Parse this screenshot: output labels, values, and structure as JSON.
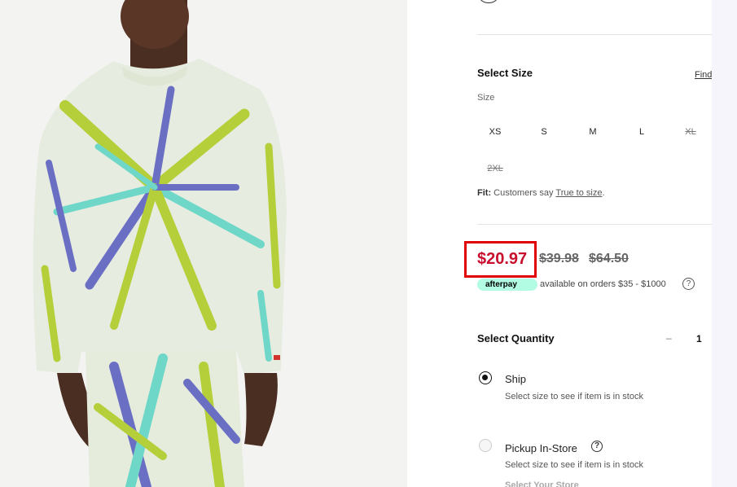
{
  "product_image": {
    "alt": "tie-dye crewneck sweatshirt and matching pants worn by model"
  },
  "size_section": {
    "title": "Select Size",
    "find_link": "Find",
    "size_label": "Size",
    "sizes": [
      {
        "label": "XS",
        "available": true
      },
      {
        "label": "S",
        "available": true
      },
      {
        "label": "M",
        "available": true
      },
      {
        "label": "L",
        "available": true
      },
      {
        "label": "XL",
        "available": false
      },
      {
        "label": "2XL",
        "available": false
      }
    ],
    "fit_prefix": "Fit:",
    "fit_text": "Customers say",
    "fit_link": "True to size",
    "fit_suffix": "."
  },
  "price": {
    "sale": "$20.97",
    "was_1": "$39.98",
    "was_2": "$64.50",
    "highlight_color": "#e00000",
    "sale_color": "#c8102e"
  },
  "afterpay": {
    "badge": "afterpay",
    "text": "available on orders $35 - $1000",
    "help_glyph": "?"
  },
  "quantity": {
    "title": "Select Quantity",
    "minus": "–",
    "value": "1"
  },
  "fulfillment": {
    "ship_label": "Ship",
    "ship_sub": "Select size to see if item is in stock",
    "pickup_label": "Pickup In-Store",
    "pickup_sub": "Select size to see if item is in stock",
    "pickup_info_glyph": "?",
    "select_store": "Select Your Store"
  }
}
